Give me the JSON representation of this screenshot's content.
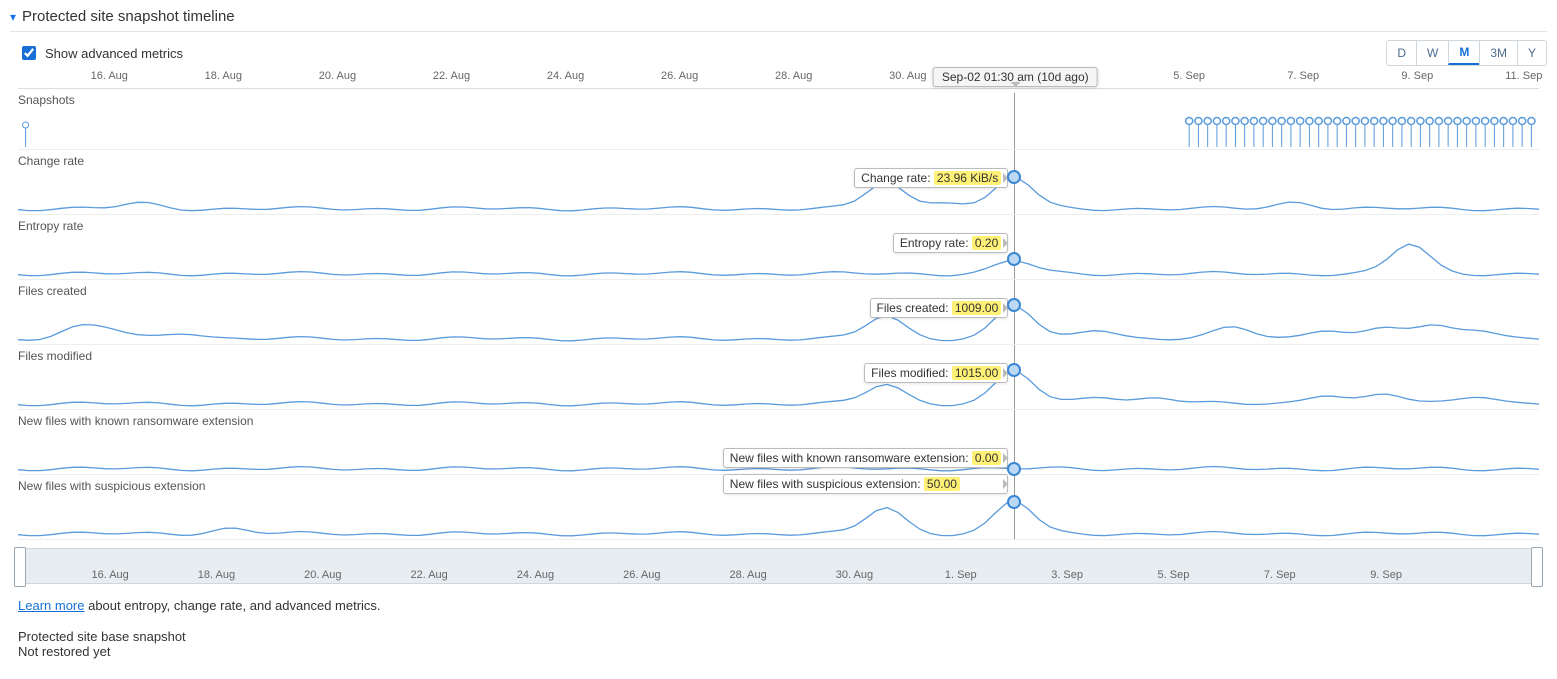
{
  "header": {
    "title": "Protected site snapshot timeline",
    "show_advanced_label": "Show advanced metrics",
    "show_advanced_checked": true
  },
  "range_buttons": [
    "D",
    "W",
    "M",
    "3M",
    "Y"
  ],
  "range_active": "M",
  "axis_ticks_top": [
    "16. Aug",
    "18. Aug",
    "20. Aug",
    "22. Aug",
    "24. Aug",
    "26. Aug",
    "28. Aug",
    "30. Aug",
    "5. Sep",
    "7. Sep",
    "9. Sep",
    "11. Sep"
  ],
  "axis_ticks_top_pct": [
    6,
    13.5,
    21,
    28.5,
    36,
    43.5,
    51,
    58.5,
    77,
    84.5,
    92,
    99
  ],
  "axis_ticks_nav": [
    "16. Aug",
    "18. Aug",
    "20. Aug",
    "22. Aug",
    "24. Aug",
    "26. Aug",
    "28. Aug",
    "30. Aug",
    "1. Sep",
    "3. Sep",
    "5. Sep",
    "7. Sep",
    "9. Sep"
  ],
  "axis_ticks_nav_pct": [
    6,
    13,
    20,
    27,
    34,
    41,
    48,
    55,
    62,
    69,
    76,
    83,
    90
  ],
  "cursor": {
    "pct": 65.5,
    "label": "Sep-02 01:30 am (10d ago)"
  },
  "rows": {
    "snapshots": {
      "label": "Snapshots"
    },
    "change_rate": {
      "label": "Change rate",
      "flag_label": "Change rate:",
      "flag_value": "23.96 KiB/s"
    },
    "entropy_rate": {
      "label": "Entropy rate",
      "flag_label": "Entropy rate:",
      "flag_value": "0.20"
    },
    "files_created": {
      "label": "Files created",
      "flag_label": "Files created:",
      "flag_value": "1009.00"
    },
    "files_modified": {
      "label": "Files modified",
      "flag_label": "Files modified:",
      "flag_value": "1015.00"
    },
    "ransom_ext": {
      "label": "New files with known ransomware extension",
      "flag_label": "New files with known ransomware extension:",
      "flag_value": "0.00"
    },
    "susp_ext": {
      "label": "New files with suspicious extension",
      "flag_label": "New files with suspicious extension:",
      "flag_value": "50.00"
    }
  },
  "footer": {
    "learn_more": "Learn more",
    "learn_more_tail": " about entropy, change rate, and advanced metrics.",
    "base_snapshot": "Protected site base snapshot",
    "not_restored": "Not restored yet"
  },
  "chart_data": {
    "type": "line",
    "xlabel": "",
    "ylabel": "",
    "cursor_time": "Sep-02 01:30 am",
    "x_range": [
      "16. Aug",
      "11. Sep"
    ],
    "series": [
      {
        "name": "Snapshots",
        "type": "lollipop",
        "unit": "count",
        "start_pct": 77,
        "end_pct": 99.5,
        "count": 38
      },
      {
        "name": "Change rate",
        "unit": "KiB/s",
        "value_at_cursor": 23.96,
        "baseline": 2,
        "peaks_pct": [
          8,
          57,
          61,
          65.5,
          84
        ],
        "peak_values": [
          4,
          20,
          6,
          23.96,
          5
        ]
      },
      {
        "name": "Entropy rate",
        "unit": "ratio",
        "value_at_cursor": 0.2,
        "baseline": 0.12,
        "peaks_pct": [
          65.5,
          91.5
        ],
        "peak_values": [
          0.2,
          0.45
        ]
      },
      {
        "name": "Files created",
        "unit": "files",
        "value_at_cursor": 1009.0,
        "baseline": 80,
        "peaks_pct": [
          4,
          6,
          11,
          57,
          65.5,
          71,
          80,
          86,
          90,
          93,
          96
        ],
        "peak_values": [
          300,
          250,
          200,
          700,
          1009,
          300,
          350,
          300,
          320,
          350,
          300
        ]
      },
      {
        "name": "Files modified",
        "unit": "files",
        "value_at_cursor": 1015.0,
        "baseline": 90,
        "peaks_pct": [
          57,
          65.5,
          71,
          75,
          86,
          90,
          96
        ],
        "peak_values": [
          600,
          1015,
          250,
          200,
          300,
          280,
          260
        ]
      },
      {
        "name": "New files with known ransomware extension",
        "unit": "files",
        "value_at_cursor": 0.0,
        "baseline": 0,
        "peaks_pct": [],
        "peak_values": []
      },
      {
        "name": "New files with suspicious extension",
        "unit": "files",
        "value_at_cursor": 50.0,
        "baseline": 1,
        "peaks_pct": [
          14,
          57,
          65.5
        ],
        "peak_values": [
          8,
          40,
          50
        ]
      }
    ]
  }
}
